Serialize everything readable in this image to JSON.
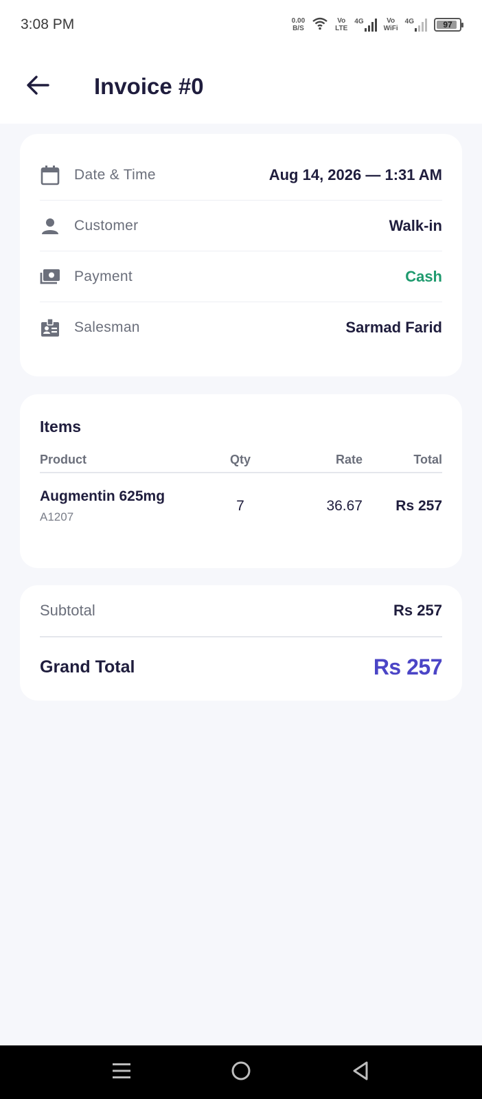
{
  "status_bar": {
    "time": "3:08 PM",
    "net_speed_value": "0.00",
    "net_speed_unit": "B/S",
    "volte_top": "Vo",
    "volte_bottom": "LTE",
    "sim1_type": "4G",
    "vowifi_top": "Vo",
    "vowifi_bottom": "WiFi",
    "sim2_type": "4G",
    "battery_level": "97",
    "battery_fraction": 0.97
  },
  "header": {
    "title": "Invoice #0",
    "back_icon": "arrow-left-icon"
  },
  "info": {
    "rows": [
      {
        "icon": "calendar-icon",
        "label": "Date & Time",
        "value": "Aug 14, 2026 — 1:31 AM"
      },
      {
        "icon": "person-icon",
        "label": "Customer",
        "value": "Walk-in"
      },
      {
        "icon": "cash-icon",
        "label": "Payment",
        "value": "Cash"
      },
      {
        "icon": "badge-icon",
        "label": "Salesman",
        "value": "Sarmad Farid"
      }
    ]
  },
  "items": {
    "title": "Items",
    "columns": {
      "product": "Product",
      "qty": "Qty",
      "rate": "Rate",
      "total": "Total"
    },
    "rows": [
      {
        "name": "Augmentin 625mg",
        "code": "A1207",
        "qty": "7",
        "rate": "36.67",
        "total": "Rs 257"
      }
    ]
  },
  "totals": {
    "subtotal_label": "Subtotal",
    "subtotal_value": "Rs 257",
    "grand_label": "Grand Total",
    "grand_value": "Rs 257"
  },
  "colors": {
    "accent": "#4b45c6",
    "cash": "#1e9a6e",
    "text": "#1f1d3d",
    "muted": "#6b6f7b",
    "background": "#f6f7fb"
  },
  "nav": {
    "menu_icon": "menu-icon",
    "home_icon": "home-circle-icon",
    "back_icon": "triangle-back-icon"
  }
}
